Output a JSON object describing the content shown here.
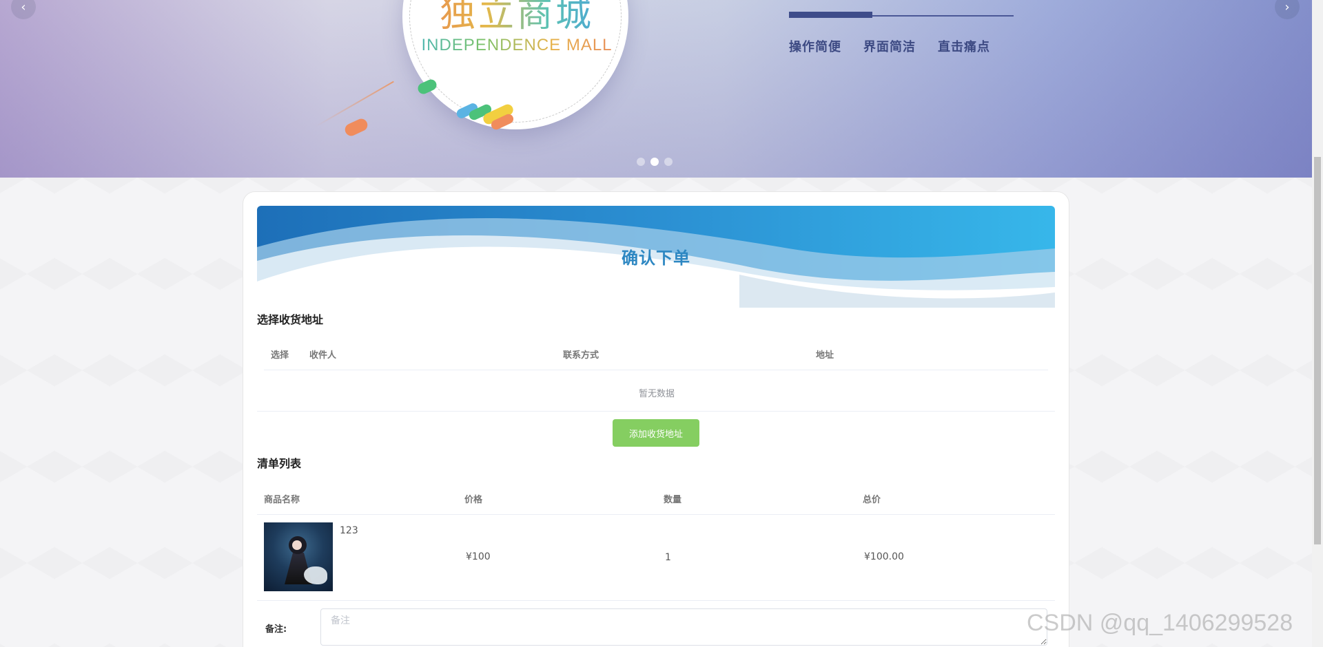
{
  "banner": {
    "logo_cn": "独立商城",
    "logo_en": "INDEPENDENCE MALL",
    "tags": [
      "操作简便",
      "界面简洁",
      "直击痛点"
    ],
    "progress_fraction": 0.37,
    "prev_arrow": "‹",
    "next_arrow": "›",
    "slide_count": 3,
    "active_slide": 2
  },
  "order": {
    "title": "确认下单"
  },
  "address_section": {
    "title": "选择收货地址",
    "columns": {
      "select": "选择",
      "recipient": "收件人",
      "contact": "联系方式",
      "address": "地址"
    },
    "empty_text": "暂无数据",
    "add_button": "添加收货地址"
  },
  "cart_section": {
    "title": "清单列表",
    "columns": {
      "name": "商品名称",
      "price": "价格",
      "quantity": "数量",
      "total": "总价"
    },
    "rows": [
      {
        "name": "123",
        "price": "¥100",
        "quantity": "1",
        "total": "¥100.00"
      }
    ]
  },
  "remark": {
    "label": "备注:",
    "placeholder": "备注"
  },
  "watermark": "CSDN @qq_1406299528",
  "colors": {
    "accent_blue": "#2d87c2",
    "add_button_green": "#85ce61",
    "banner_text": "#3d4a83"
  }
}
